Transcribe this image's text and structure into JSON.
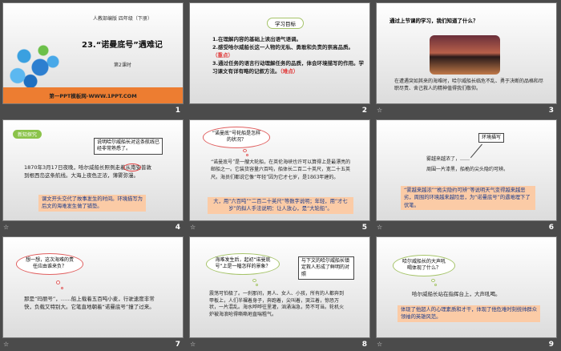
{
  "slides": [
    {
      "number": "1",
      "subtitle": "人教部编版 四年级（下册）",
      "title": "23.“诺曼底号”遇难记",
      "lesson": "第2课时",
      "footer": "第一PPT模板网-WWW.1PPT.COM"
    },
    {
      "number": "2",
      "heading": "学习目标",
      "item1": "1.在理解内容的基础上读出语气语调。",
      "item2": "2.感受哈尔威船长这一人物的无私、勇敢和负责的崇高品质。",
      "item2_tag": "（重点）",
      "item3": "3.通过任务的语言行动理解任务的品质，体会环境描写的作用。学习课文有详有略的记叙方法。",
      "item3_tag": "（难点）"
    },
    {
      "number": "3",
      "question": "通过上节课的学习，我们知道了什么？",
      "body": "在遭遇突如其来的海难时，哈尔威船长临危不乱、勇于决断的品格和尽职尽责、舍己救人的精神值得我们敬仰。"
    },
    {
      "number": "4",
      "badge": "新知探究",
      "callout": "说明哈尔威船长对这条航线已经非常熟悉了。",
      "body": "1870年3月17日夜晚，哈尔威船长照例走着从南安普敦到根西岛这条航线。大海上夜色正浓，薄雾弥漫。",
      "note": "课文开头交代了故事发生的时间。环境描写为后文的海难发生做了铺垫。"
    },
    {
      "number": "5",
      "cloud": "“诺曼底”号轮船是怎样的状况？",
      "body": "“诺曼底号”是一艘大轮船，在英伦海峡也许可以算得上是最漂亮的邮船之一。它装货容量六百吨，船体长二百二十英尺，宽二十五英尺。海员们都说它像“年轻”因为它才七岁，是1863年建的。",
      "note": "大，用“六百吨”“二百二十英尺”等数字说明；年轻，用“才七岁”的拟人手法说明：让人放心，是“大轮船”。"
    },
    {
      "number": "6",
      "callout": "环境描写",
      "line1": "雾越来越浓了，……",
      "line2": "周围一片漆黑，船桅的尖头隐约可辨。",
      "note": "“雾越来越浓”“桅尖隐约可辨”等说明天气变得越来越恶劣，周围的环境越来越险恶，为“诺曼底号”的遇难埋下了伏笔。"
    },
    {
      "number": "7",
      "cloud": "想一想，这次海难的责任应由谁来负？",
      "body": "那是“玛丽号”，……船上载着五百吨小麦，行驶速度非常快，负载又特别大。它笔直地朝着“诺曼底号”撞了过来。"
    },
    {
      "number": "8",
      "cloud": "海难发生后，起初“诺曼底号”上是一幅怎样的景象？",
      "callout": "与下文的哈尔威船长镇定救人形成了鲜明的对照",
      "body": "震荡可怕极了。一刹那间，男人、女人、小孩，所有的人都奔到甲板上，人们半裸着身子，奔跑着，尖叫着，哭泣着，惊恐万状，一片混乱。海水哗哗往里灌，汹涌湍急，势不可当。轮机火炉被海浪呛得嘶嘶地直喘粗气。"
    },
    {
      "number": "9",
      "cloud": "哈尔威船长的大声吼喝体现了什么？",
      "body": "哈尔威船长站在指挥台上，大声吼喝。",
      "note": "体现了他超人的心理素质和才干，体现了他危难时刻统帅群众领袖的英雄风范。"
    }
  ],
  "colors": {
    "accent": "#ed7d31",
    "note_bg": "#fbcba6",
    "green": "#8bc34a"
  }
}
